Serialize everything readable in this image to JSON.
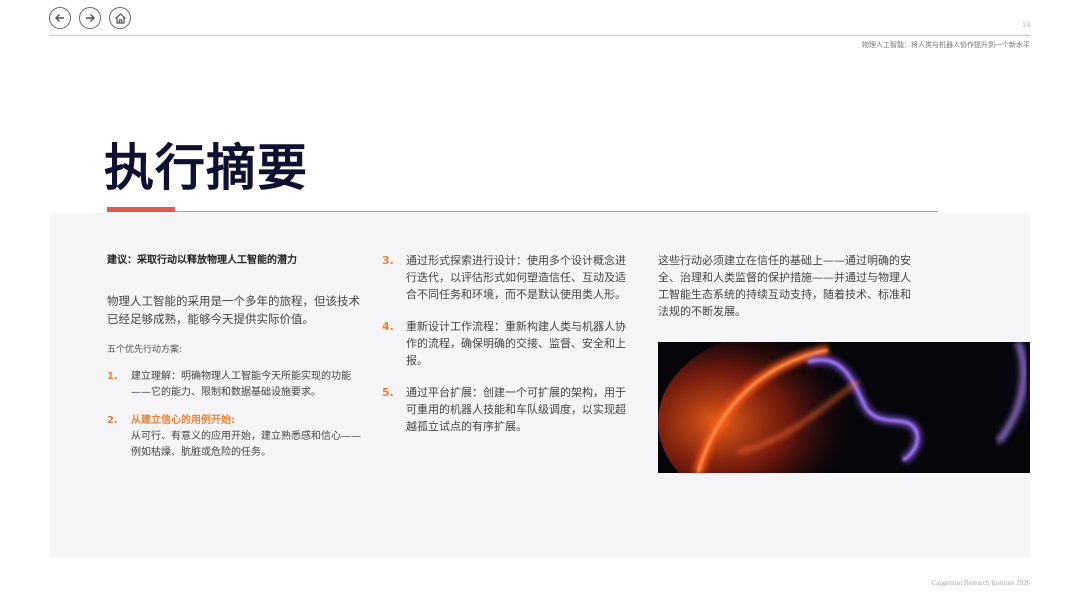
{
  "header": {
    "page_number": "13",
    "subtitle": "物理人工智能：将人类与机器人协作提升到一个新水平"
  },
  "nav": {
    "icons": [
      "back-arrow-icon",
      "forward-arrow-icon",
      "home-icon"
    ]
  },
  "title": "执行摘要",
  "colors": {
    "accent_red": "#e35a52",
    "accent_orange": "#e8843a",
    "title": "#101030",
    "panel_bg": "#f5f5f7"
  },
  "col1": {
    "rec_title": "建议：采取行动以释放物理人工智能的潜力",
    "intro": "物理人工智能的采用是一个多年的旅程，但该技术已经足够成熟，能够今天提供实际价值。",
    "five_actions": "五个优先行动方案:",
    "items": [
      {
        "num": "1.",
        "text": "建立理解：明确物理人工智能今天所能实现的功能——它的能力、限制和数据基础设施要求。"
      },
      {
        "num": "2.",
        "head": "从建立信心的用例开始:",
        "text": "从可行、有意义的应用开始，建立熟悉感和信心——例如枯燥、肮脏或危险的任务。"
      }
    ]
  },
  "col2": {
    "items": [
      {
        "num": "3.",
        "text": "通过形式探索进行设计：使用多个设计概念进行迭代，以评估形式如何塑造信任、互动及适合不同任务和环境，而不是默认使用类人形。"
      },
      {
        "num": "4.",
        "text": "重新设计工作流程：重新构建人类与机器人协作的流程，确保明确的交接、监督、安全和上报。"
      },
      {
        "num": "5.",
        "text": "通过平台扩展：创建一个可扩展的架构，用于可重用的机器人技能和车队级调度，以实现超越孤立试点的有序扩展。"
      }
    ]
  },
  "col3": {
    "text": "这些行动必须建立在信任的基础上——通过明确的安全、治理和人类监督的保护措施——并通过与物理人工智能生态系统的持续互动支持，随着技术、标准和法规的不断发展。"
  },
  "footer": "Capgemini Research Institute 2026"
}
